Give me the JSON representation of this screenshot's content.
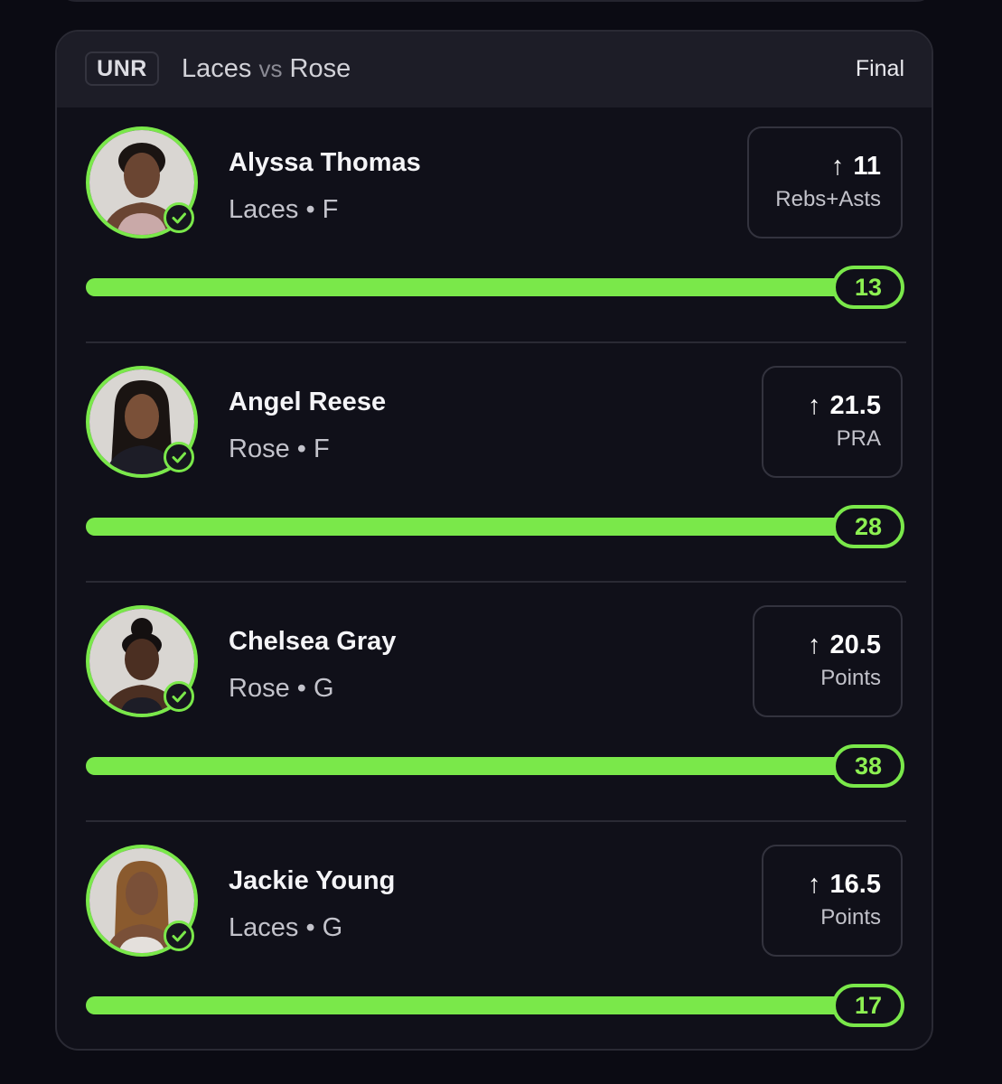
{
  "game": {
    "badge": "UNR",
    "team_a": "Laces",
    "vs": "vs",
    "team_b": "Rose",
    "status": "Final"
  },
  "picks": [
    {
      "name": "Alyssa Thomas",
      "team": "Laces",
      "position": "F",
      "direction": "↑",
      "line": "11",
      "stat": "Rebs+Asts",
      "result": "13",
      "progress": 1.0
    },
    {
      "name": "Angel Reese",
      "team": "Rose",
      "position": "F",
      "direction": "↑",
      "line": "21.5",
      "stat": "PRA",
      "result": "28",
      "progress": 1.0
    },
    {
      "name": "Chelsea Gray",
      "team": "Rose",
      "position": "G",
      "direction": "↑",
      "line": "20.5",
      "stat": "Points",
      "result": "38",
      "progress": 1.0
    },
    {
      "name": "Jackie Young",
      "team": "Laces",
      "position": "G",
      "direction": "↑",
      "line": "16.5",
      "stat": "Points",
      "result": "17",
      "progress": 1.0
    }
  ],
  "separator": "•",
  "colors": {
    "accent": "#7ae84a",
    "background": "#0b0b13",
    "card": "#101019",
    "header": "#1d1d27"
  },
  "icons": {
    "avatar_badge": "check-circle-icon",
    "direction": "arrow-up-icon"
  }
}
